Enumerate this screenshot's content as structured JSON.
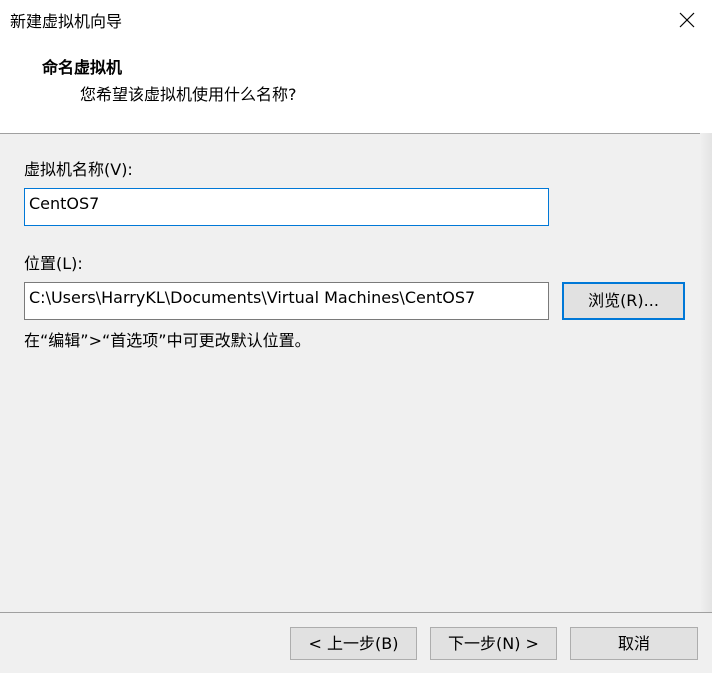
{
  "window": {
    "title": "新建虚拟机向导"
  },
  "header": {
    "title": "命名虚拟机",
    "subtitle": "您希望该虚拟机使用什么名称?"
  },
  "form": {
    "name_label": "虚拟机名称(V):",
    "name_value": "CentOS7",
    "location_label": "位置(L):",
    "location_value": "C:\\Users\\HarryKL\\Documents\\Virtual Machines\\CentOS7",
    "browse_label": "浏览(R)...",
    "hint": "在“编辑”>“首选项”中可更改默认位置。"
  },
  "footer": {
    "back_label": "< 上一步(B)",
    "next_label": "下一步(N) >",
    "cancel_label": "取消"
  },
  "colors": {
    "accent": "#0078d7",
    "window_bg": "#f0f0f0",
    "header_bg": "#ffffff"
  },
  "icons": {
    "close": "close-icon"
  }
}
